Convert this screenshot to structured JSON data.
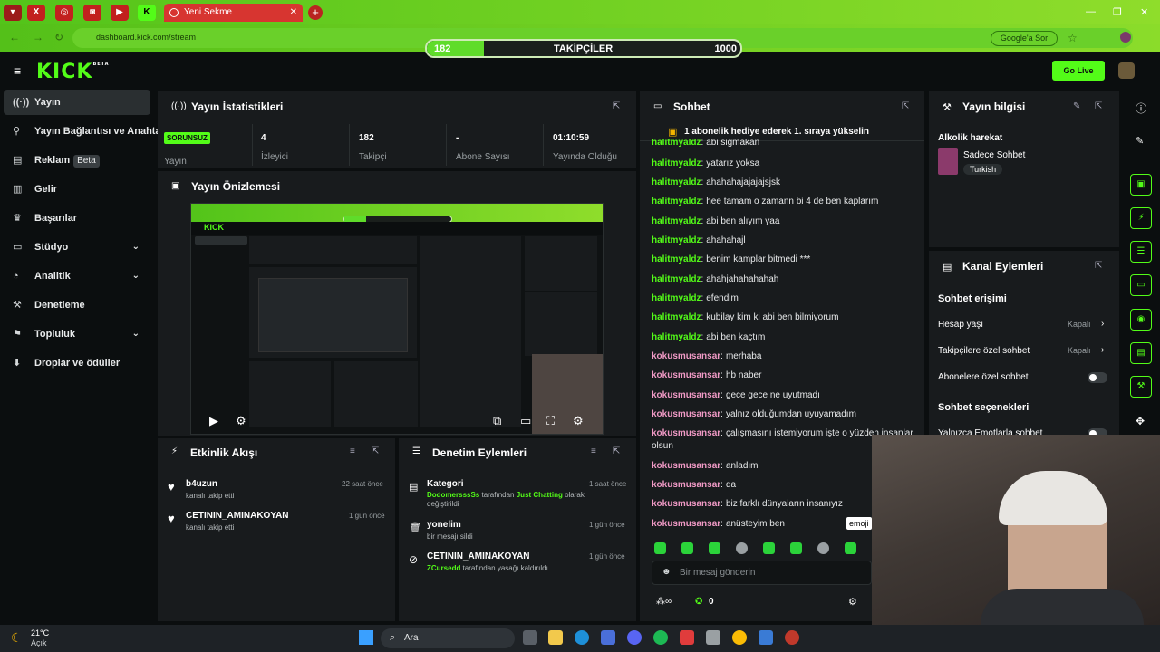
{
  "browser": {
    "tab_title": "Yeni Sekme",
    "tab_close": "✕",
    "new_tab": "+",
    "url": "dashboard.kick.com/stream",
    "google_label": "Google'a Sor",
    "pinned_tabs": [
      "▾",
      "X",
      "◎",
      "◙",
      "▶",
      "K"
    ],
    "win_min": "—",
    "win_max": "❐",
    "win_close": "✕"
  },
  "follower_goal": {
    "current": "182",
    "label": "TAKİPÇİLER",
    "target": "1000",
    "progress": 0.182
  },
  "kick": {
    "logo": "KICK",
    "logo_badge": "BETA",
    "go_live": "Go Live"
  },
  "sidebar": {
    "items": [
      {
        "label": "Yayın",
        "icon": "((·))"
      },
      {
        "label": "Yayın Bağlantısı ve Anahtarı",
        "icon": "⚲"
      },
      {
        "label": "Reklam",
        "icon": "▤",
        "badge": "Beta"
      },
      {
        "label": "Gelir",
        "icon": "▥"
      },
      {
        "label": "Başarılar",
        "icon": "♛"
      },
      {
        "label": "Stüdyo",
        "icon": "▭",
        "chevron": "⌄"
      },
      {
        "label": "Analitik",
        "icon": "◔",
        "chevron": "⌄"
      },
      {
        "label": "Denetleme",
        "icon": "⚒"
      },
      {
        "label": "Topluluk",
        "icon": "⚑",
        "chevron": "⌄"
      },
      {
        "label": "Droplar ve ödüller",
        "icon": "⬇"
      }
    ]
  },
  "stats": {
    "title": "Yayın İstatistikleri",
    "badge": "SORUNSUZ",
    "stream_label": "Yayın",
    "viewers_value": "4",
    "viewers_label": "İzleyici",
    "followers_value": "182",
    "followers_label": "Takipçi",
    "subs_value": "-",
    "subs_label": "Abone Sayısı",
    "uptime_value": "01:10:59",
    "uptime_label": "Yayında Olduğu Süre"
  },
  "preview": {
    "title": "Yayın Önizlemesi"
  },
  "activity": {
    "title": "Etkinlik Akışı",
    "items": [
      {
        "user": "b4uzun",
        "text": "kanalı takip etti",
        "time": "22 saat önce"
      },
      {
        "user": "CETININ_AMINAKOYAN",
        "text": "kanalı takip etti",
        "time": "1 gün önce"
      }
    ]
  },
  "moderation": {
    "title": "Denetim Eylemleri",
    "items": [
      {
        "title": "Kategori",
        "actor": "DodomersssSs",
        "mid": " tarafından ",
        "target": "Just Chatting",
        "rest": " olarak değiştirildi",
        "time": "1 saat önce"
      },
      {
        "title": "yonelim",
        "text": "bir mesajı sildi",
        "time": "1 gün önce"
      },
      {
        "title": "CETININ_AMINAKOYAN",
        "actor": "ZCursedd",
        "rest": " tarafından yasağı kaldırıldı",
        "time": "1 gün önce"
      }
    ]
  },
  "chat": {
    "title": "Sohbet",
    "pinned": "1 abonelik hediye ederek 1. sıraya yükselin",
    "messages": [
      {
        "user": "halitmyaldz",
        "text": "abi sigmakan",
        "color": "green"
      },
      {
        "user": "halitmyaldz",
        "text": "yatarız yoksa",
        "color": "green"
      },
      {
        "user": "halitmyaldz",
        "text": "ahahahajajajajsjsk",
        "color": "green"
      },
      {
        "user": "halitmyaldz",
        "text": "hee tamam o zamann bi 4 de ben kaplarım",
        "color": "green"
      },
      {
        "user": "halitmyaldz",
        "text": "abi ben alıyım yaa",
        "color": "green"
      },
      {
        "user": "halitmyaldz",
        "text": "ahahahajl",
        "color": "green"
      },
      {
        "user": "halitmyaldz",
        "text": "benim kamplar bitmedi ***",
        "color": "green"
      },
      {
        "user": "halitmyaldz",
        "text": "ahahjahahahahah",
        "color": "green"
      },
      {
        "user": "halitmyaldz",
        "text": "efendim",
        "color": "green"
      },
      {
        "user": "halitmyaldz",
        "text": "kubilay kim ki abi ben bilmiyorum",
        "color": "green"
      },
      {
        "user": "halitmyaldz",
        "text": "abi ben kaçtım",
        "color": "green"
      },
      {
        "user": "kokusmusansar",
        "text": "merhaba",
        "color": "pink"
      },
      {
        "user": "kokusmusansar",
        "text": "hb naber",
        "color": "pink"
      },
      {
        "user": "kokusmusansar",
        "text": "gece gece ne uyutmadı",
        "color": "pink"
      },
      {
        "user": "kokusmusansar",
        "text": "yalnız olduğumdan uyuyamadım",
        "color": "pink"
      },
      {
        "user": "kokusmusansar",
        "text": "çalışmasını istemiyorum işte o yüzden insanlar olsun",
        "color": "pink"
      },
      {
        "user": "kokusmusansar",
        "text": "anladım",
        "color": "pink"
      },
      {
        "user": "kokusmusansar",
        "text": "da",
        "color": "pink"
      },
      {
        "user": "kokusmusansar",
        "text": "biz farklı dünyaların insanıyız",
        "color": "pink"
      },
      {
        "user": "kokusmusansar",
        "text": "anüsteyim ben",
        "color": "pink"
      }
    ],
    "emoji_tooltip": "emoji",
    "input_placeholder": "Bir mesaj gönderin",
    "points": "0",
    "colon": ":"
  },
  "stream_info": {
    "title": "Yayın bilgisi",
    "stream_title": "Alkolik harekat",
    "category": "Sadece Sohbet",
    "language": "Turkish"
  },
  "channel_actions": {
    "title": "Kanal Eylemleri",
    "section1": "Sohbet erişimi",
    "rows": [
      {
        "label": "Hesap yaşı",
        "value": "Kapalı"
      },
      {
        "label": "Takipçilere özel sohbet",
        "value": "Kapalı"
      },
      {
        "label": "Abonelere özel sohbet",
        "value": ""
      }
    ],
    "section2": "Sohbet seçenekleri",
    "row_emote": "Yalnızca Emotlarla sohbet"
  },
  "taskbar": {
    "weather_temp": "21°C",
    "weather_desc": "Açık",
    "search": "Ara"
  },
  "colors": {
    "kick_green": "#53fc18",
    "user_green": "#53fc18",
    "user_pink": "#f19ac6"
  }
}
